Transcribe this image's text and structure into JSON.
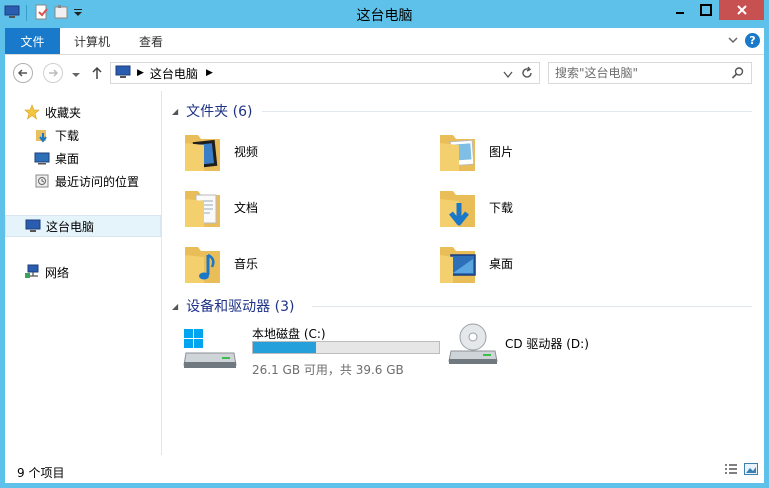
{
  "window": {
    "title": "这台电脑"
  },
  "ribbon": {
    "tabs": [
      "文件",
      "计算机",
      "查看"
    ]
  },
  "address": {
    "path": [
      "这台电脑"
    ],
    "search_placeholder": "搜索\"这台电脑\""
  },
  "nav": {
    "favorites": "收藏夹",
    "fav_items": [
      "下载",
      "桌面",
      "最近访问的位置"
    ],
    "this_pc": "这台电脑",
    "network": "网络"
  },
  "groups": {
    "folders_title": "文件夹 (6)",
    "folders": [
      {
        "name": "视频",
        "icon": "video-folder-icon"
      },
      {
        "name": "图片",
        "icon": "pictures-folder-icon"
      },
      {
        "name": "文档",
        "icon": "documents-folder-icon"
      },
      {
        "name": "下载",
        "icon": "downloads-folder-icon"
      },
      {
        "name": "音乐",
        "icon": "music-folder-icon"
      },
      {
        "name": "桌面",
        "icon": "desktop-folder-icon"
      }
    ],
    "devices_title": "设备和驱动器 (3)",
    "drives": [
      {
        "name": "本地磁盘 (C:)",
        "info": "26.1 GB 可用，共 39.6 GB",
        "used_fraction": 0.34,
        "icon": "windows-drive-icon"
      },
      {
        "name": "CD 驱动器 (D:)",
        "icon": "cd-drive-icon"
      }
    ]
  },
  "status": {
    "items": "9 个项目"
  },
  "colors": {
    "accent": "#1979ca",
    "titlebar": "#5ec1e9",
    "bar_fill": "#26a0da",
    "close": "#c75050"
  }
}
